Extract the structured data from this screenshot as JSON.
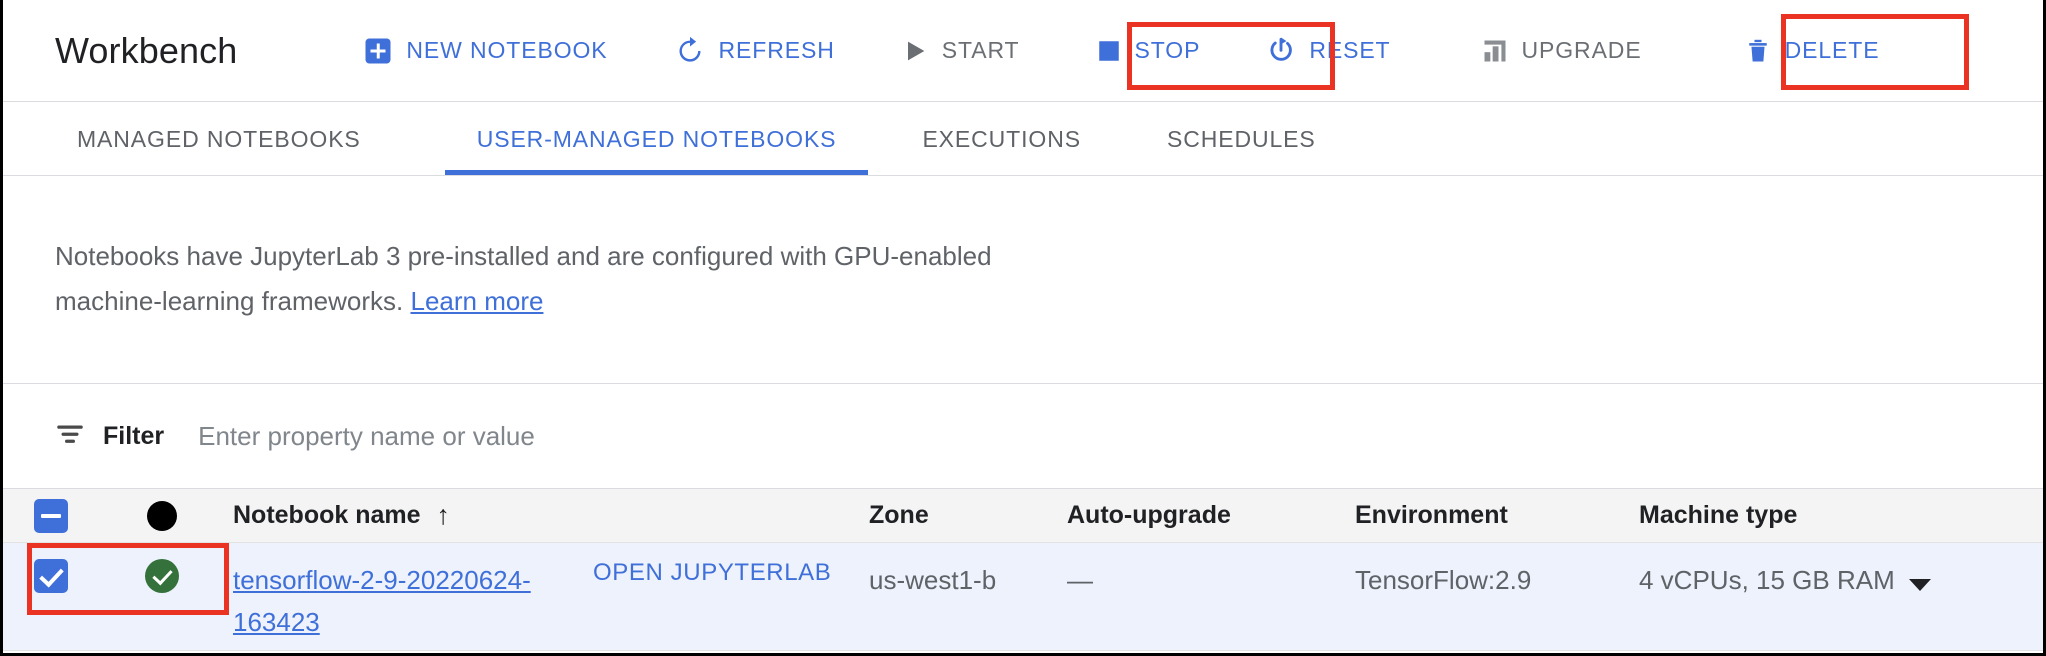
{
  "header": {
    "title": "Workbench",
    "actions": [
      {
        "label": "NEW NOTEBOOK",
        "icon": "add-box-icon",
        "state": "enabled"
      },
      {
        "label": "REFRESH",
        "icon": "refresh-icon",
        "state": "enabled"
      },
      {
        "label": "START",
        "icon": "play-icon",
        "state": "disabled"
      },
      {
        "label": "STOP",
        "icon": "stop-square-icon",
        "state": "enabled"
      },
      {
        "label": "RESET",
        "icon": "power-reset-icon",
        "state": "enabled"
      },
      {
        "label": "UPGRADE",
        "icon": "upgrade-bars-icon",
        "state": "disabled"
      },
      {
        "label": "DELETE",
        "icon": "trash-icon",
        "state": "enabled"
      }
    ]
  },
  "tabs": [
    {
      "label": "MANAGED NOTEBOOKS",
      "active": false
    },
    {
      "label": "USER-MANAGED NOTEBOOKS",
      "active": true
    },
    {
      "label": "EXECUTIONS",
      "active": false
    },
    {
      "label": "SCHEDULES",
      "active": false
    }
  ],
  "description": {
    "text": "Notebooks have JupyterLab 3 pre-installed and are configured with GPU-enabled machine-learning frameworks.",
    "link_label": "Learn more"
  },
  "filter": {
    "icon": "filter-list-icon",
    "label": "Filter",
    "placeholder": "Enter property name or value",
    "value": ""
  },
  "table": {
    "select_all_state": "indeterminate",
    "status_header_icon": "status-circle-icon",
    "columns": {
      "name": "Notebook name",
      "sort_indicator": "↑",
      "zone": "Zone",
      "auto_upgrade": "Auto-upgrade",
      "environment": "Environment",
      "machine_type": "Machine type"
    },
    "rows": [
      {
        "selected": true,
        "status_icon": "check-circle-green-icon",
        "name": "tensorflow-2-9-20220624-163423",
        "open_label": "OPEN JUPYTERLAB",
        "zone": "us-west1-b",
        "auto_upgrade": "—",
        "environment": "TensorFlow:2.9",
        "machine_type": "4 vCPUs, 15 GB RAM"
      }
    ]
  },
  "colors": {
    "accent_blue": "#3f6fd8",
    "disabled_gray": "#6b6f74",
    "annotation_red": "#ea3323",
    "row_selected_bg": "#edf2fc",
    "status_green": "#34713b"
  },
  "annotations": [
    {
      "target": "stop-button"
    },
    {
      "target": "delete-button"
    },
    {
      "target": "row-select-and-status"
    }
  ]
}
